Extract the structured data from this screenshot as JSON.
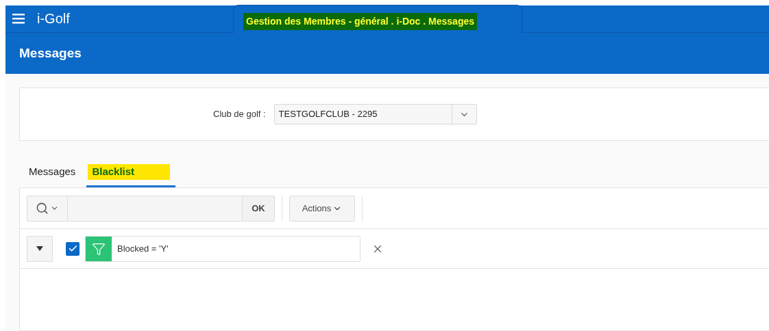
{
  "app": {
    "name": "i-Golf"
  },
  "window_tab": {
    "title": "Gestion des Membres - général . i-Doc . Messages"
  },
  "page": {
    "title": "Messages"
  },
  "club_field": {
    "label": "Club de golf :",
    "value": "TESTGOLFCLUB - 2295"
  },
  "tabs": [
    {
      "label": "Messages",
      "selected": false
    },
    {
      "label": "Blacklist",
      "selected": true
    }
  ],
  "toolbar": {
    "ok_label": "OK",
    "actions_label": "Actions"
  },
  "filter": {
    "checked": true,
    "text": "Blocked = 'Y'"
  }
}
